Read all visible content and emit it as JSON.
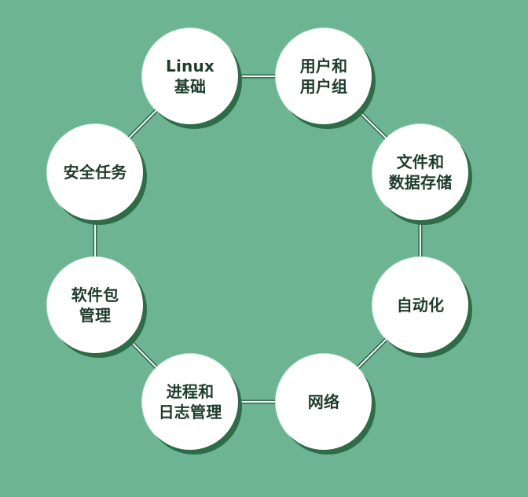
{
  "diagram": {
    "nodes": [
      {
        "key": "linux",
        "label": "Linux\n基础"
      },
      {
        "key": "users",
        "label": "用户和\n用户组"
      },
      {
        "key": "files",
        "label": "文件和\n数据存储"
      },
      {
        "key": "automation",
        "label": "自动化"
      },
      {
        "key": "network",
        "label": "网络"
      },
      {
        "key": "process",
        "label": "进程和\n日志管理"
      },
      {
        "key": "package",
        "label": "软件包\n管理"
      },
      {
        "key": "security",
        "label": "安全任务"
      }
    ],
    "connections": [
      [
        "linux",
        "users"
      ],
      [
        "users",
        "files"
      ],
      [
        "files",
        "automation"
      ],
      [
        "automation",
        "network"
      ],
      [
        "network",
        "process"
      ],
      [
        "process",
        "package"
      ],
      [
        "package",
        "security"
      ],
      [
        "security",
        "linux"
      ]
    ]
  }
}
